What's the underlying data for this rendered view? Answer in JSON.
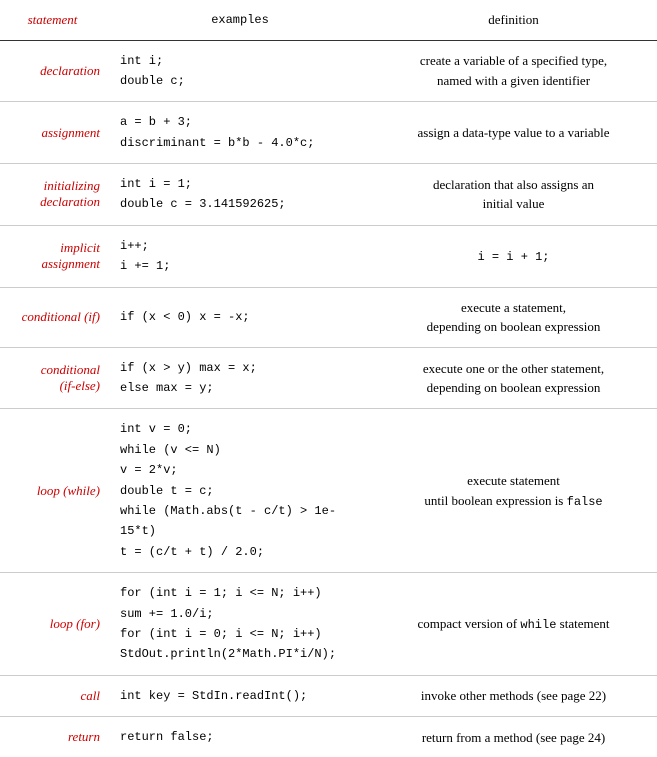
{
  "header": {
    "col1": "statement",
    "col2": "examples",
    "col3": "definition"
  },
  "rows": [
    {
      "id": "declaration",
      "statement": "declaration",
      "examples_html": "int i;\ndouble c;",
      "definition_html": "create a variable of a specified type,\nnamed with a given identifier"
    },
    {
      "id": "assignment",
      "statement": "assignment",
      "examples_html": "a = b + 3;\ndiscriminant = b*b - 4.0*c;",
      "definition_html": "assign a data-type value to a variable"
    },
    {
      "id": "initializing-declaration",
      "statement": "initializing\ndeclaration",
      "examples_html": "int i = 1;\ndouble c = 3.141592625;",
      "definition_html": "declaration that also assigns an\ninitial value"
    },
    {
      "id": "implicit-assignment",
      "statement": "implicit\nassignment",
      "examples_html": "i++;\ni += 1;",
      "definition_html": "i = i + 1;"
    },
    {
      "id": "conditional-if",
      "statement": "conditional (if)",
      "examples_html": "if (x < 0) x = -x;",
      "definition_html": "execute a statement,\ndepending on boolean expression"
    },
    {
      "id": "conditional-if-else",
      "statement": "conditional\n(if-else)",
      "examples_html": "if (x > y) max = x;\nelse       max = y;",
      "definition_html": "execute one or the other statement,\ndepending on boolean expression"
    },
    {
      "id": "loop-while",
      "statement": "loop (while)",
      "examples_html": "int v = 0;\nwhile (v <= N)\n    v = 2*v;\ndouble t = c;\nwhile (Math.abs(t - c/t) > 1e-15*t)\n    t = (c/t + t) / 2.0;",
      "definition_html": "execute statement\nuntil boolean expression is false"
    },
    {
      "id": "loop-for",
      "statement": "loop (for)",
      "examples_html": "for (int i = 1; i <= N; i++)\n    sum += 1.0/i;\nfor (int i = 0; i <= N; i++)\n    StdOut.println(2*Math.PI*i/N);",
      "definition_html": "compact version of while statement"
    },
    {
      "id": "call",
      "statement": "call",
      "examples_html": "int key = StdIn.readInt();",
      "definition_html": "invoke other methods (see page 22)"
    },
    {
      "id": "return",
      "statement": "return",
      "examples_html": "return false;",
      "definition_html": "return from a method (see page 24)"
    }
  ]
}
